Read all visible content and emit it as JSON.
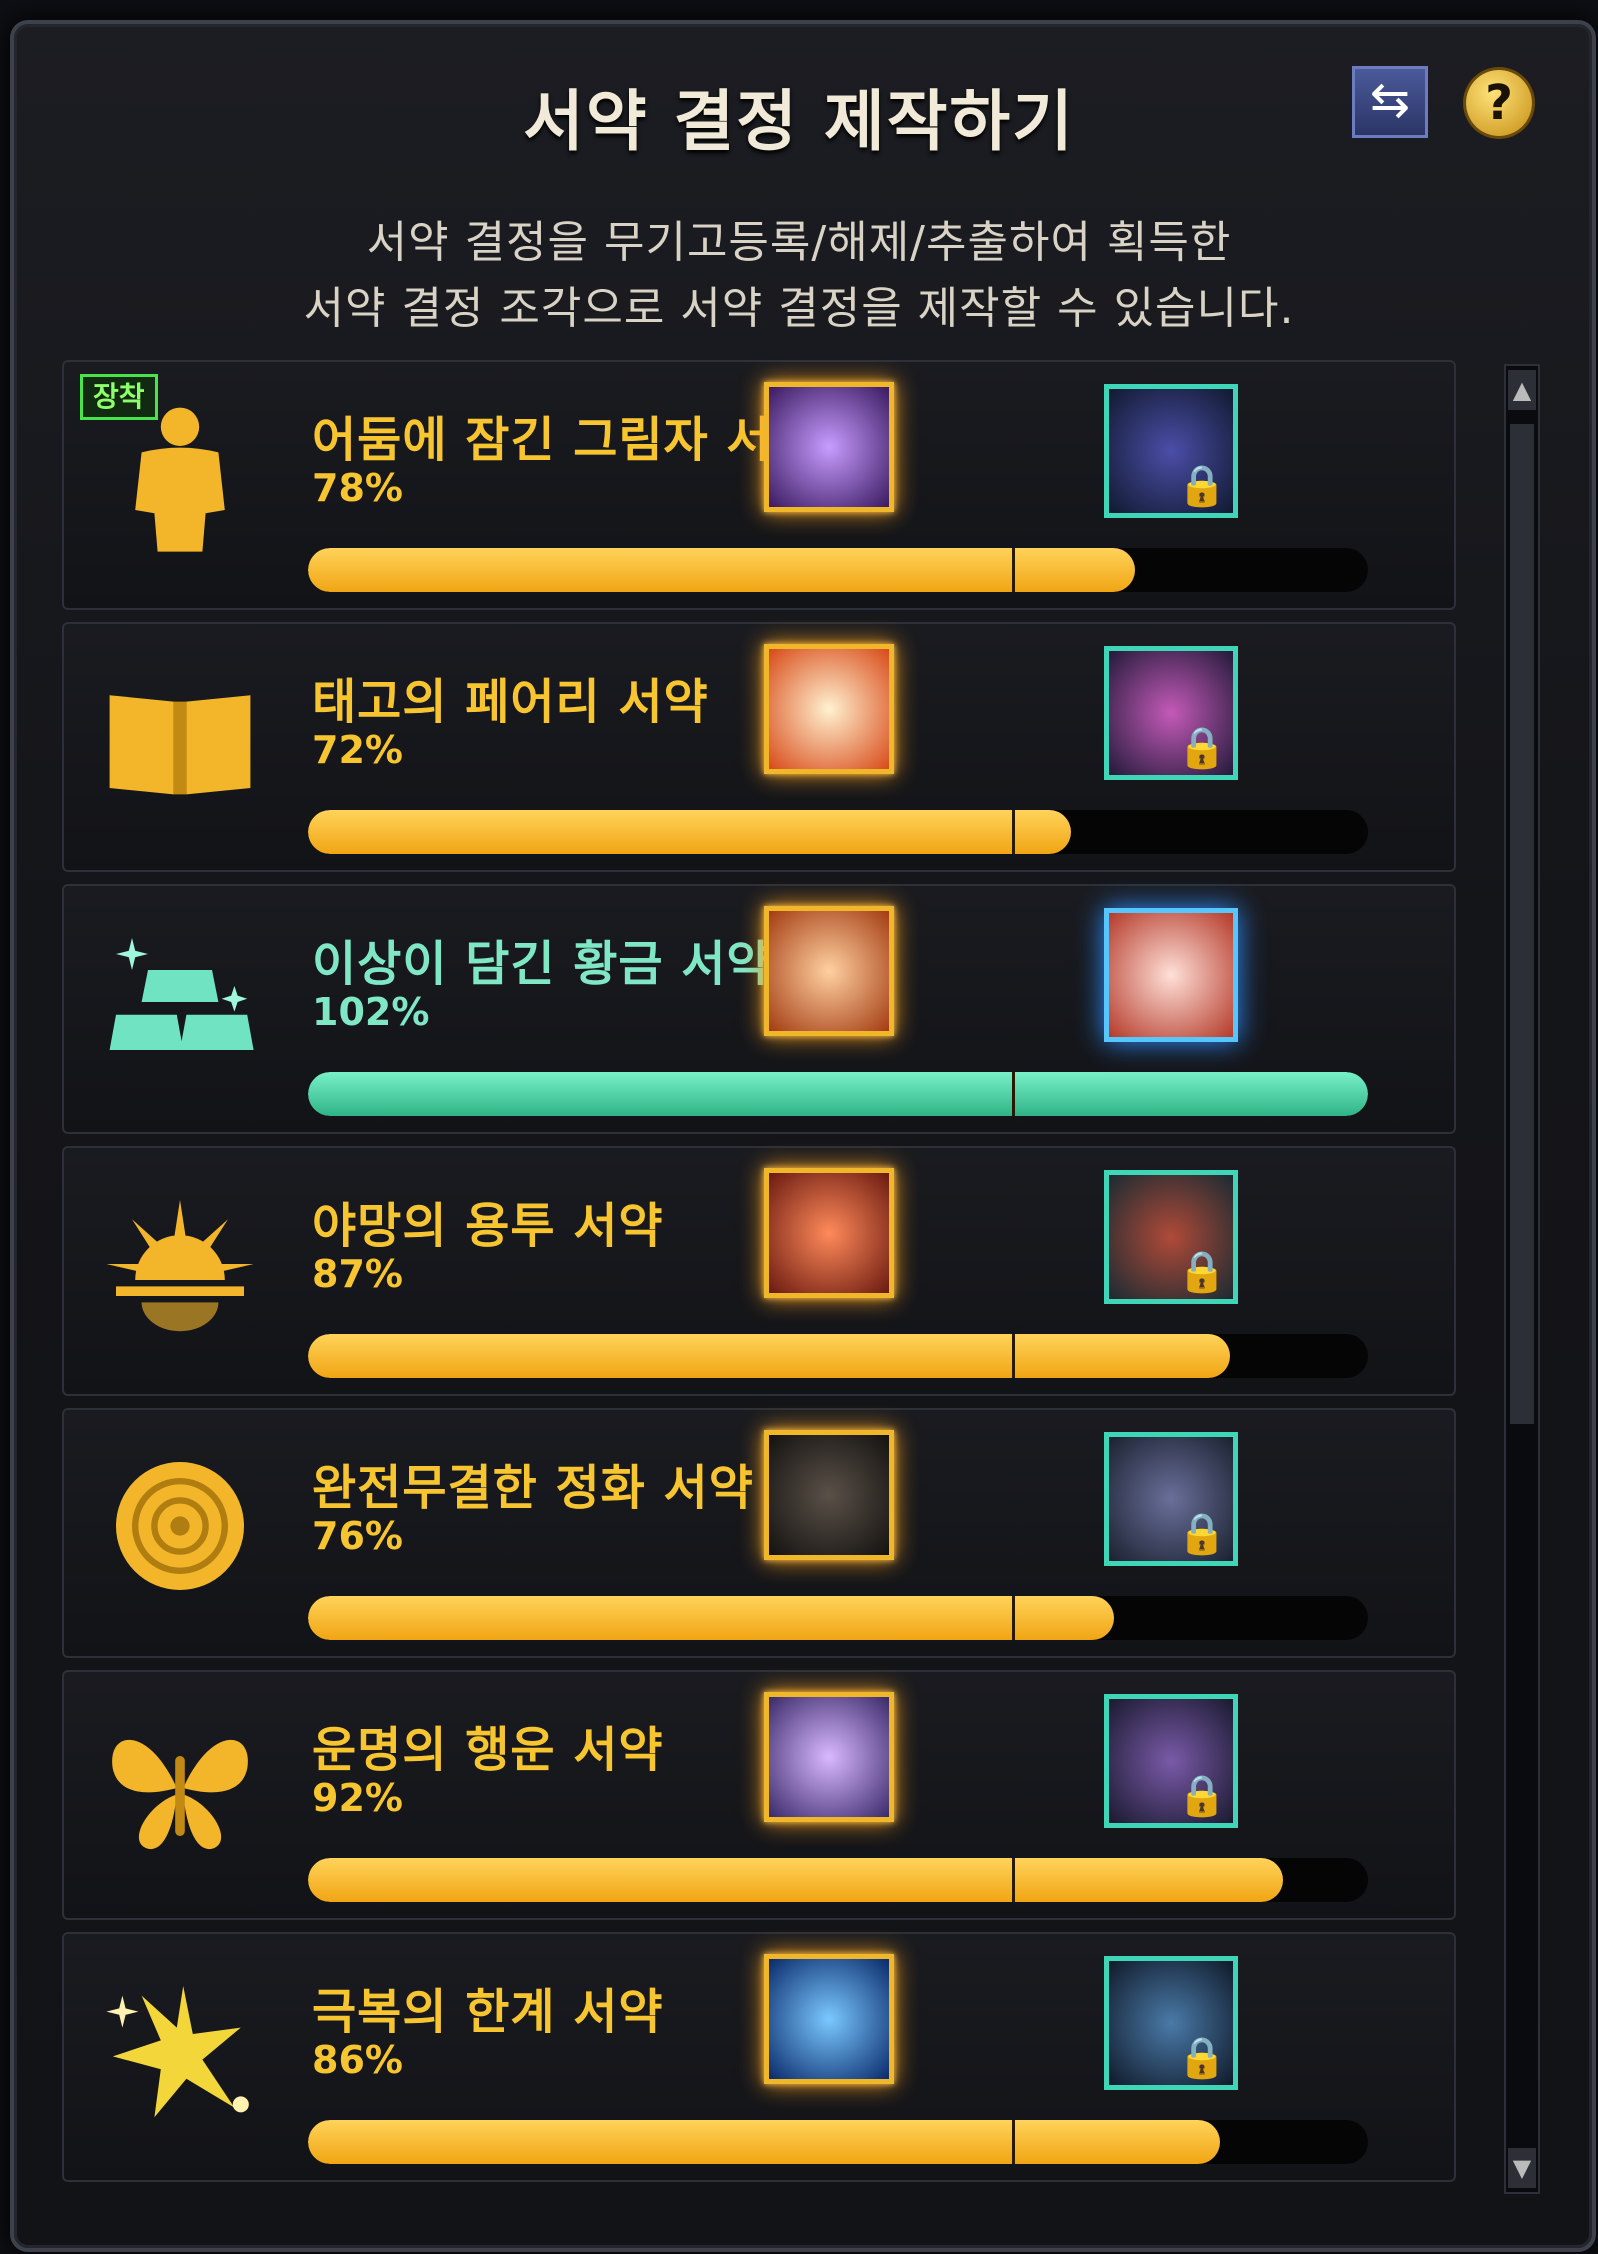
{
  "window": {
    "title": "서약 결정 제작하기",
    "swap_label": "⇆",
    "help_label": "?",
    "description_line1": "서약 결정을 무기고등록/해제/추출하여 획득한",
    "description_line2": "서약 결정 조각으로 서약 결정을 제작할 수 있습니다."
  },
  "colors": {
    "accent": "#f7c530",
    "complete": "#7fe7c4"
  },
  "items": [
    {
      "name": "어둠에 잠긴 그림자 서약",
      "percent_label": "78%",
      "progress": 0.78,
      "icon": "golden-body-icon",
      "badge": "장착",
      "complete": false
    },
    {
      "name": "태고의 페어리 서약",
      "percent_label": "72%",
      "progress": 0.72,
      "icon": "open-book-icon",
      "complete": false
    },
    {
      "name": "이상이 담긴 황금 서약",
      "percent_label": "102%",
      "progress": 1.0,
      "icon": "gold-bars-icon",
      "complete": true
    },
    {
      "name": "야망의 용투 서약",
      "percent_label": "87%",
      "progress": 0.87,
      "icon": "sun-icon",
      "complete": false
    },
    {
      "name": "완전무결한 정화 서약",
      "percent_label": "76%",
      "progress": 0.76,
      "icon": "rose-icon",
      "complete": false
    },
    {
      "name": "운명의 행운 서약",
      "percent_label": "92%",
      "progress": 0.92,
      "icon": "butterfly-icon",
      "complete": false
    },
    {
      "name": "극복의 한계 서약",
      "percent_label": "86%",
      "progress": 0.86,
      "icon": "star-burst-icon",
      "complete": false
    }
  ]
}
